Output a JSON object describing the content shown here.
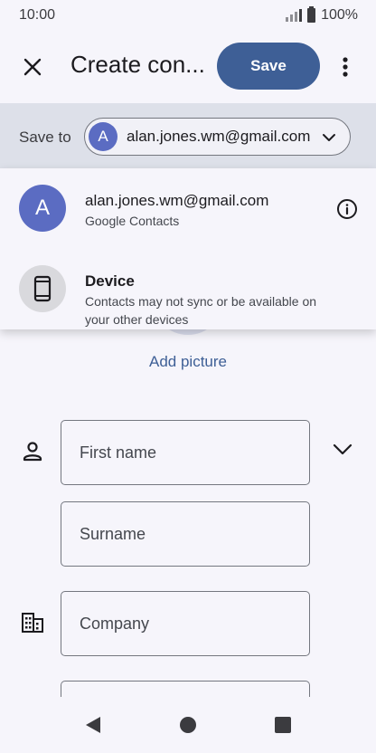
{
  "status_bar": {
    "time": "10:00",
    "battery": "100%"
  },
  "app_bar": {
    "title": "Create con...",
    "save_label": "Save"
  },
  "save_to": {
    "label": "Save to",
    "selected_account_initial": "A",
    "selected_account_email": "alan.jones.wm@gmail.com"
  },
  "dropdown": {
    "options": [
      {
        "avatar": "A",
        "title": "alan.jones.wm@gmail.com",
        "subtitle": "Google Contacts",
        "icon": "info-icon"
      },
      {
        "avatar": "phone-icon",
        "title": "Device",
        "subtitle": "Contacts may not sync or be available on your other devices"
      }
    ]
  },
  "picture": {
    "add_label": "Add picture"
  },
  "form": {
    "first_name_placeholder": "First name",
    "surname_placeholder": "Surname",
    "company_placeholder": "Company"
  },
  "colors": {
    "accent": "#3e5f96",
    "avatar": "#5b6cc2",
    "banner": "#dde0e9"
  }
}
